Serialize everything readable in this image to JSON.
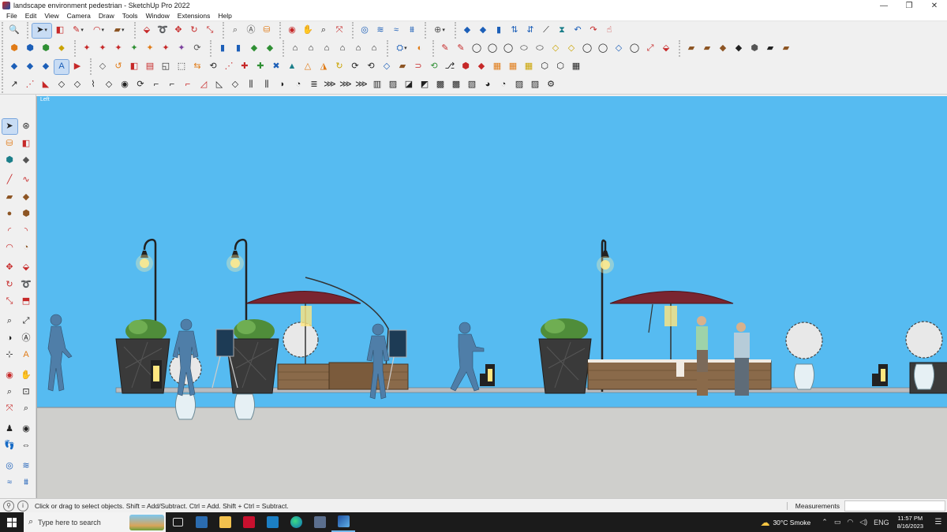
{
  "window": {
    "title": "landscape environment pedestrian - SketchUp Pro 2022",
    "minimize": "—",
    "restore": "❐",
    "close": "✕"
  },
  "menu": [
    "File",
    "Edit",
    "View",
    "Camera",
    "Draw",
    "Tools",
    "Window",
    "Extensions",
    "Help"
  ],
  "view_label": "Left",
  "status": {
    "hint": "Click or drag to select objects. Shift = Add/Subtract. Ctrl = Add. Shift + Ctrl = Subtract.",
    "measurements_label": "Measurements",
    "measurements_value": ""
  },
  "taskbar": {
    "search_placeholder": "Type here to search",
    "weather": "30°C  Smoke",
    "language": "ENG",
    "time": "11:57 PM",
    "date": "8/16/2023"
  },
  "colors": {
    "sky": "#56bbf1",
    "ground": "#cfcfcc",
    "umbrella": "#7a2530",
    "planter": "#3a3a3a",
    "bench_wood": "#8a6a4a",
    "pedestrian": "#4f7ea8"
  }
}
